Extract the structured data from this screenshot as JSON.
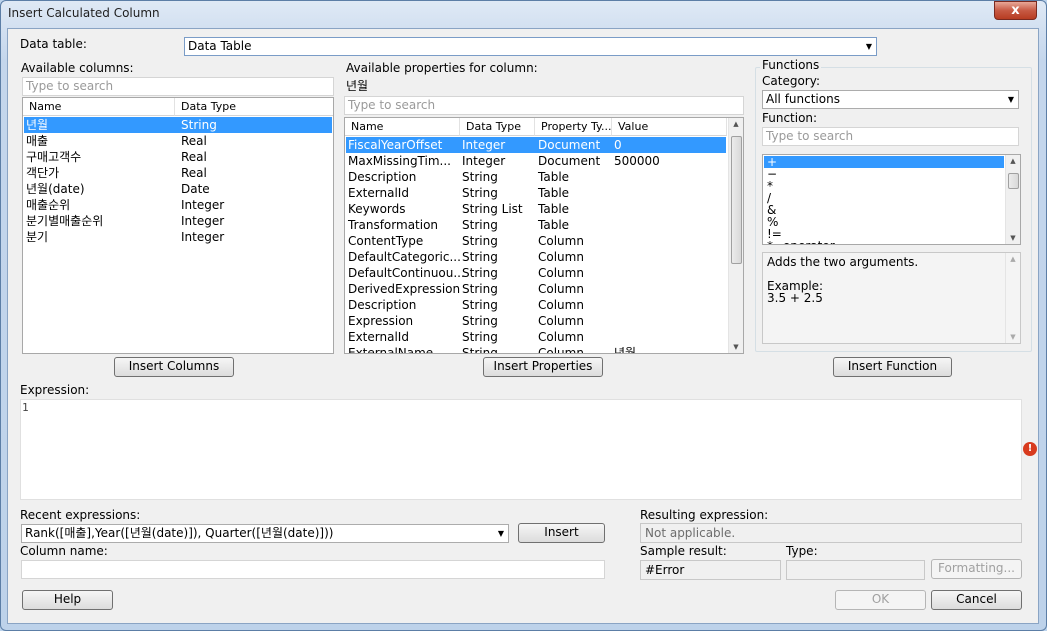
{
  "window": {
    "title": "Insert Calculated Column",
    "close_glyph": "x"
  },
  "data_table": {
    "label": "Data table:",
    "value": "Data Table"
  },
  "available_columns": {
    "label": "Available columns:",
    "search_placeholder": "Type to search",
    "headers": [
      "Name",
      "Data Type"
    ],
    "rows": [
      {
        "name": "년월",
        "type": "String"
      },
      {
        "name": "매출",
        "type": "Real"
      },
      {
        "name": "구매고객수",
        "type": "Real"
      },
      {
        "name": "객단가",
        "type": "Real"
      },
      {
        "name": "년월(date)",
        "type": "Date"
      },
      {
        "name": "매출순위",
        "type": "Integer"
      },
      {
        "name": "분기별매출순위",
        "type": "Integer"
      },
      {
        "name": "분기",
        "type": "Integer"
      }
    ],
    "insert_button": "Insert Columns"
  },
  "available_properties": {
    "label": "Available properties for column:",
    "column": "년월",
    "search_placeholder": "Type to search",
    "headers": [
      "Name",
      "Data Type",
      "Property Ty...",
      "Value"
    ],
    "rows": [
      {
        "name": "FiscalYearOffset",
        "type": "Integer",
        "ptype": "Document",
        "value": "0"
      },
      {
        "name": "MaxMissingTim...",
        "type": "Integer",
        "ptype": "Document",
        "value": "500000"
      },
      {
        "name": "Description",
        "type": "String",
        "ptype": "Table",
        "value": ""
      },
      {
        "name": "ExternalId",
        "type": "String",
        "ptype": "Table",
        "value": ""
      },
      {
        "name": "Keywords",
        "type": "String List",
        "ptype": "Table",
        "value": ""
      },
      {
        "name": "Transformation",
        "type": "String",
        "ptype": "Table",
        "value": ""
      },
      {
        "name": "ContentType",
        "type": "String",
        "ptype": "Column",
        "value": ""
      },
      {
        "name": "DefaultCategoric...",
        "type": "String",
        "ptype": "Column",
        "value": ""
      },
      {
        "name": "DefaultContinuou...",
        "type": "String",
        "ptype": "Column",
        "value": ""
      },
      {
        "name": "DerivedExpression",
        "type": "String",
        "ptype": "Column",
        "value": ""
      },
      {
        "name": "Description",
        "type": "String",
        "ptype": "Column",
        "value": ""
      },
      {
        "name": "Expression",
        "type": "String",
        "ptype": "Column",
        "value": ""
      },
      {
        "name": "ExternalId",
        "type": "String",
        "ptype": "Column",
        "value": ""
      },
      {
        "name": "ExternalName",
        "type": "String",
        "ptype": "Column",
        "value": "년월"
      }
    ],
    "insert_button": "Insert Properties"
  },
  "functions": {
    "group_label": "Functions",
    "category_label": "Category:",
    "category_value": "All functions",
    "function_label": "Function:",
    "search_placeholder": "Type to search",
    "items": [
      "+",
      "−",
      "*",
      "/",
      "&",
      "%",
      "!=",
      "*=operator"
    ],
    "description": "Adds the two arguments.",
    "example_label": "Example:",
    "example": "3.5 + 2.5",
    "insert_button": "Insert Function"
  },
  "expression": {
    "label": "Expression:",
    "line_number": "1",
    "error_icon": "error-icon"
  },
  "recent": {
    "label": "Recent expressions:",
    "value": "Rank([매출],Year([년월(date)]), Quarter([년월(date)]))",
    "insert_button": "Insert"
  },
  "column_name": {
    "label": "Column name:",
    "value": ""
  },
  "resulting": {
    "label": "Resulting expression:",
    "value": "Not applicable."
  },
  "sample": {
    "label": "Sample result:",
    "value": "#Error"
  },
  "type": {
    "label": "Type:",
    "value": ""
  },
  "buttons": {
    "formatting": "Formatting...",
    "help": "Help",
    "ok": "OK",
    "cancel": "Cancel"
  }
}
